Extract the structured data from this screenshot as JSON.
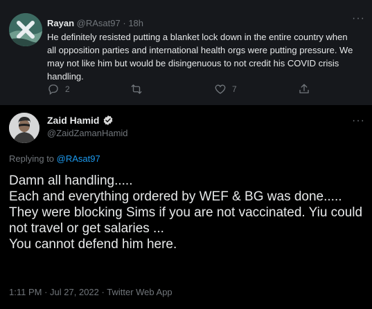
{
  "reply": {
    "name": "Rayan",
    "handle": "@RAsat97",
    "separator": "·",
    "time": "18h",
    "text": "He definitely resisted putting a blanket lock down in the entire country when all opposition parties and international health orgs were putting pressure. We may not like him but would be disingenuous to not credit his COVID crisis handling.",
    "replies_count": "2",
    "retweets_count": "",
    "likes_count": "7"
  },
  "tweet": {
    "name": "Zaid Hamid",
    "handle": "@ZaidZamanHamid",
    "replying_prefix": "Replying to",
    "replying_to": "@RAsat97",
    "lines": [
      "Damn all handling.....",
      "Each and everything ordered by WEF & BG was done.....",
      "They were blocking Sims if you are not vaccinated. Yiu could not travel or get salaries ...",
      "You cannot defend him here."
    ],
    "time": "1:11 PM",
    "separator": "·",
    "date": "Jul 27, 2022",
    "source": "Twitter Web App"
  },
  "colors": {
    "background": "#000000",
    "reply_background": "#16181c",
    "text": "#e7e9ea",
    "muted": "#71767b",
    "accent": "#1d9bf0"
  }
}
